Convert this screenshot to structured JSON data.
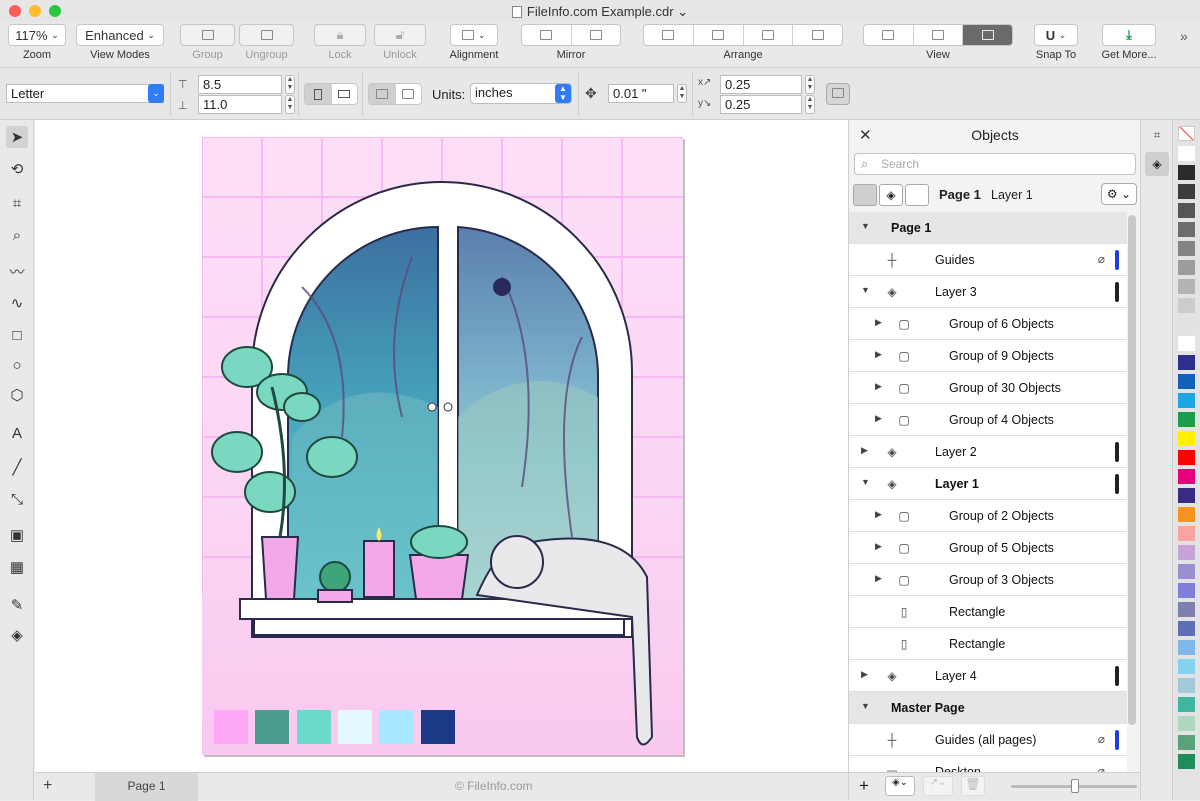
{
  "window": {
    "title": "FileInfo.com Example.cdr",
    "title_chevron": "⌄"
  },
  "toolbar": {
    "zoom": {
      "value": "117%",
      "label": "Zoom"
    },
    "view_modes": {
      "value": "Enhanced",
      "label": "View Modes"
    },
    "group": "Group",
    "ungroup": "Ungroup",
    "lock": "Lock",
    "unlock": "Unlock",
    "alignment": "Alignment",
    "mirror": "Mirror",
    "arrange": "Arrange",
    "view": "View",
    "snap_to": "Snap To",
    "get_more": "Get More...",
    "overflow": "»"
  },
  "property_bar": {
    "paper": "Letter",
    "width": "8.5",
    "height": "11.0",
    "units_label": "Units:",
    "units": "inches",
    "nudge": "0.01 \"",
    "dup_x": "0.25",
    "dup_y": "0.25"
  },
  "canvas": {
    "page_tab": "Page 1",
    "copyright": "© FileInfo.com",
    "add_page": "+",
    "swatches": [
      "#ffa8f5",
      "#4a9e8e",
      "#6bd9cb",
      "#e4f8ff",
      "#a8e9ff",
      "#1a3a86"
    ]
  },
  "objects": {
    "title": "Objects",
    "search_placeholder": "Search",
    "current_page": "Page 1",
    "current_layer": "Layer 1",
    "tree": [
      {
        "label": "Page 1",
        "level": 0,
        "type": "page",
        "expanded": true
      },
      {
        "label": "Guides",
        "level": 1,
        "type": "guides"
      },
      {
        "label": "Layer 3",
        "level": 1,
        "type": "layer",
        "expanded": true
      },
      {
        "label": "Group of 6 Objects",
        "level": 2,
        "type": "group"
      },
      {
        "label": "Group of 9 Objects",
        "level": 2,
        "type": "group"
      },
      {
        "label": "Group of 30 Objects",
        "level": 2,
        "type": "group"
      },
      {
        "label": "Group of 4 Objects",
        "level": 2,
        "type": "group"
      },
      {
        "label": "Layer 2",
        "level": 1,
        "type": "layer",
        "expanded": false
      },
      {
        "label": "Layer 1",
        "level": 1,
        "type": "layer",
        "expanded": true,
        "active": true
      },
      {
        "label": "Group of 2 Objects",
        "level": 2,
        "type": "group"
      },
      {
        "label": "Group of 5 Objects",
        "level": 2,
        "type": "group"
      },
      {
        "label": "Group of 3 Objects",
        "level": 2,
        "type": "group"
      },
      {
        "label": "Rectangle",
        "level": 2,
        "type": "rect"
      },
      {
        "label": "Rectangle",
        "level": 2,
        "type": "rect"
      },
      {
        "label": "Layer 4",
        "level": 1,
        "type": "layer",
        "expanded": false
      },
      {
        "label": "Master Page",
        "level": 0,
        "type": "page",
        "expanded": true
      },
      {
        "label": "Guides (all pages)",
        "level": 1,
        "type": "guides"
      },
      {
        "label": "Desktop",
        "level": 1,
        "type": "desktop"
      }
    ]
  },
  "palette": [
    "#ffffff",
    "#2b2b2b",
    "#3d3d3d",
    "#555555",
    "#6c6c6c",
    "#848484",
    "#9c9c9c",
    "#b4b4b4",
    "#cccccc",
    "#e2e2e2",
    "#ffffff",
    "#2e2f8c",
    "#0f62b7",
    "#1ea5e4",
    "#1a9e4b",
    "#fff000",
    "#ff0000",
    "#e6007e",
    "#3a2a84",
    "#f7941d",
    "#f9a3a3",
    "#c6a4d8",
    "#9b8fd0",
    "#7f7fd9",
    "#8080b0",
    "#5e6fb6",
    "#7fb8e8",
    "#85d1f0",
    "#a3c8d8",
    "#3fb7a0",
    "#b0d8c0",
    "#5aa37a",
    "#1f8c5a"
  ]
}
